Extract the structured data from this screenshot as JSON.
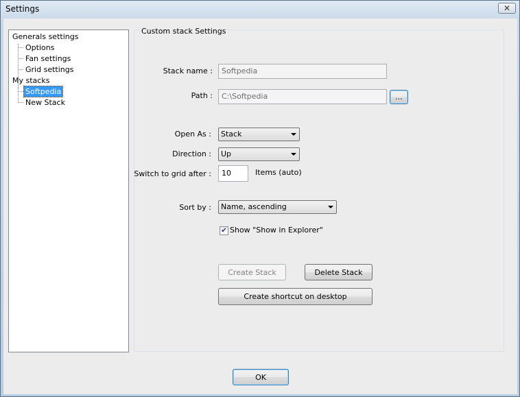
{
  "window": {
    "title": "Settings",
    "close_glyph": "✕"
  },
  "tree": {
    "items": [
      {
        "label": "Generals settings"
      },
      {
        "label": "Options"
      },
      {
        "label": "Fan settings"
      },
      {
        "label": "Grid settings"
      },
      {
        "label": "My stacks"
      },
      {
        "label": "Softpedia",
        "selected": true
      },
      {
        "label": "New Stack"
      }
    ]
  },
  "panel": {
    "title": "Custom stack Settings",
    "stack_name": {
      "label": "Stack name :",
      "value": "Softpedia"
    },
    "path": {
      "label": "Path :",
      "value": "C:\\Softpedia",
      "browse_label": "..."
    },
    "open_as": {
      "label": "Open As :",
      "value": "Stack"
    },
    "direction": {
      "label": "Direction :",
      "value": "Up"
    },
    "switch_grid": {
      "label": "Switch to grid after :",
      "value": "10",
      "suffix": "Items (auto)"
    },
    "sort_by": {
      "label": "Sort by :",
      "value": "Name, ascending"
    },
    "show_explorer": {
      "label": "Show \"Show in Explorer\"",
      "checked": true,
      "check_glyph": "✔"
    },
    "create_stack_label": "Create Stack",
    "delete_stack_label": "Delete Stack",
    "shortcut_label": "Create shortcut on desktop"
  },
  "ok_label": "OK"
}
